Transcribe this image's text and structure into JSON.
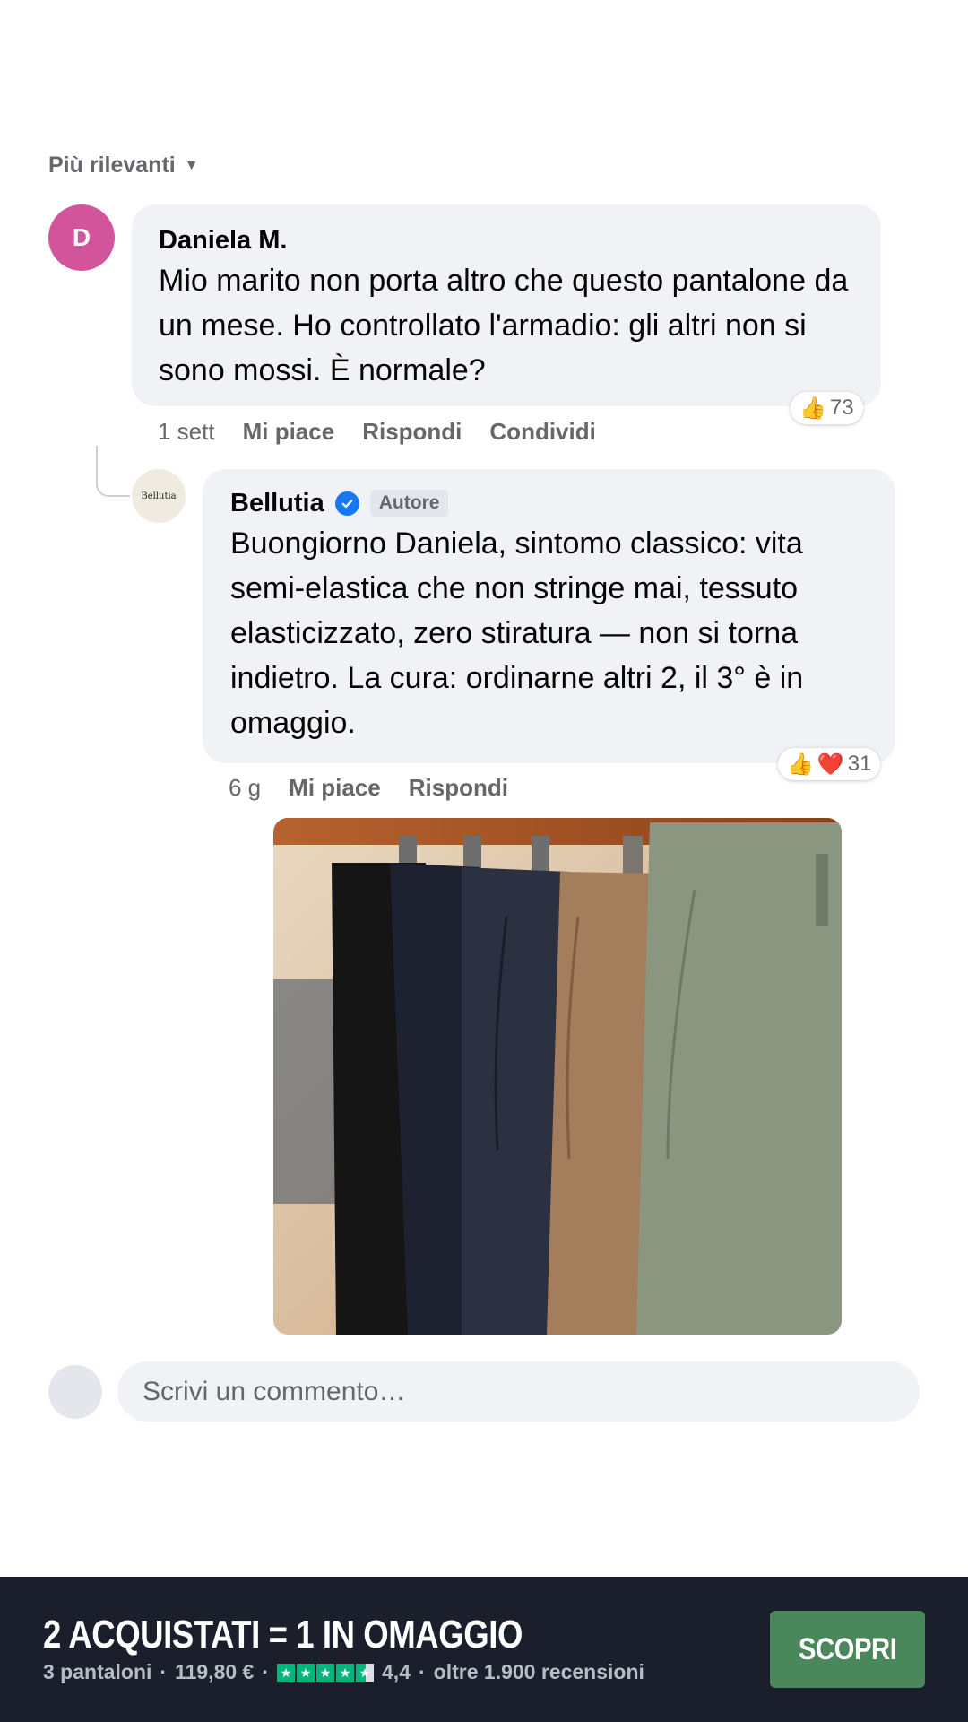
{
  "sort": {
    "label": "Più rilevanti"
  },
  "comments": [
    {
      "avatar_initial": "D",
      "author": "Daniela M.",
      "text": "Mio marito non porta altro che questo pantalone da un mese. Ho controllato l'armadio: gli altri non si sono mossi. È normale?",
      "reaction_count": "73",
      "reaction_icons": [
        "thumbs-up-icon"
      ],
      "time": "1 sett",
      "actions": [
        "Mi piace",
        "Rispondi",
        "Condividi"
      ]
    }
  ],
  "reply": {
    "avatar_text": "Bellutia",
    "author": "Bellutia",
    "badge": "Autore",
    "text": "Buongiorno Daniela, sintomo classico: vita semi-elastica che non stringe mai, tessuto elasticizzato, zero stiratura — non si torna indietro. La cura: ordinarne altri 2, il 3° è in omaggio.",
    "reaction_count": "31",
    "reaction_icons": [
      "thumbs-up-icon",
      "heart-icon"
    ],
    "time": "6 g",
    "actions": [
      "Mi piace",
      "Rispondi"
    ]
  },
  "composer": {
    "placeholder": "Scrivi un commento…"
  },
  "promo": {
    "title": "2 ACQUISTATI = 1 IN OMAGGIO",
    "products": "3 pantaloni",
    "price": "119,80 €",
    "rating": 4.4,
    "rating_text": "4,4",
    "reviews": "oltre 1.900 recensioni",
    "cta": "SCOPRI",
    "sep": "·"
  },
  "colors": {
    "accent": "#1877f2",
    "cta": "#4a875a",
    "footer_bg": "#1b1f2c",
    "avatar": "#d2559c",
    "rating_green": "#00b67a"
  }
}
